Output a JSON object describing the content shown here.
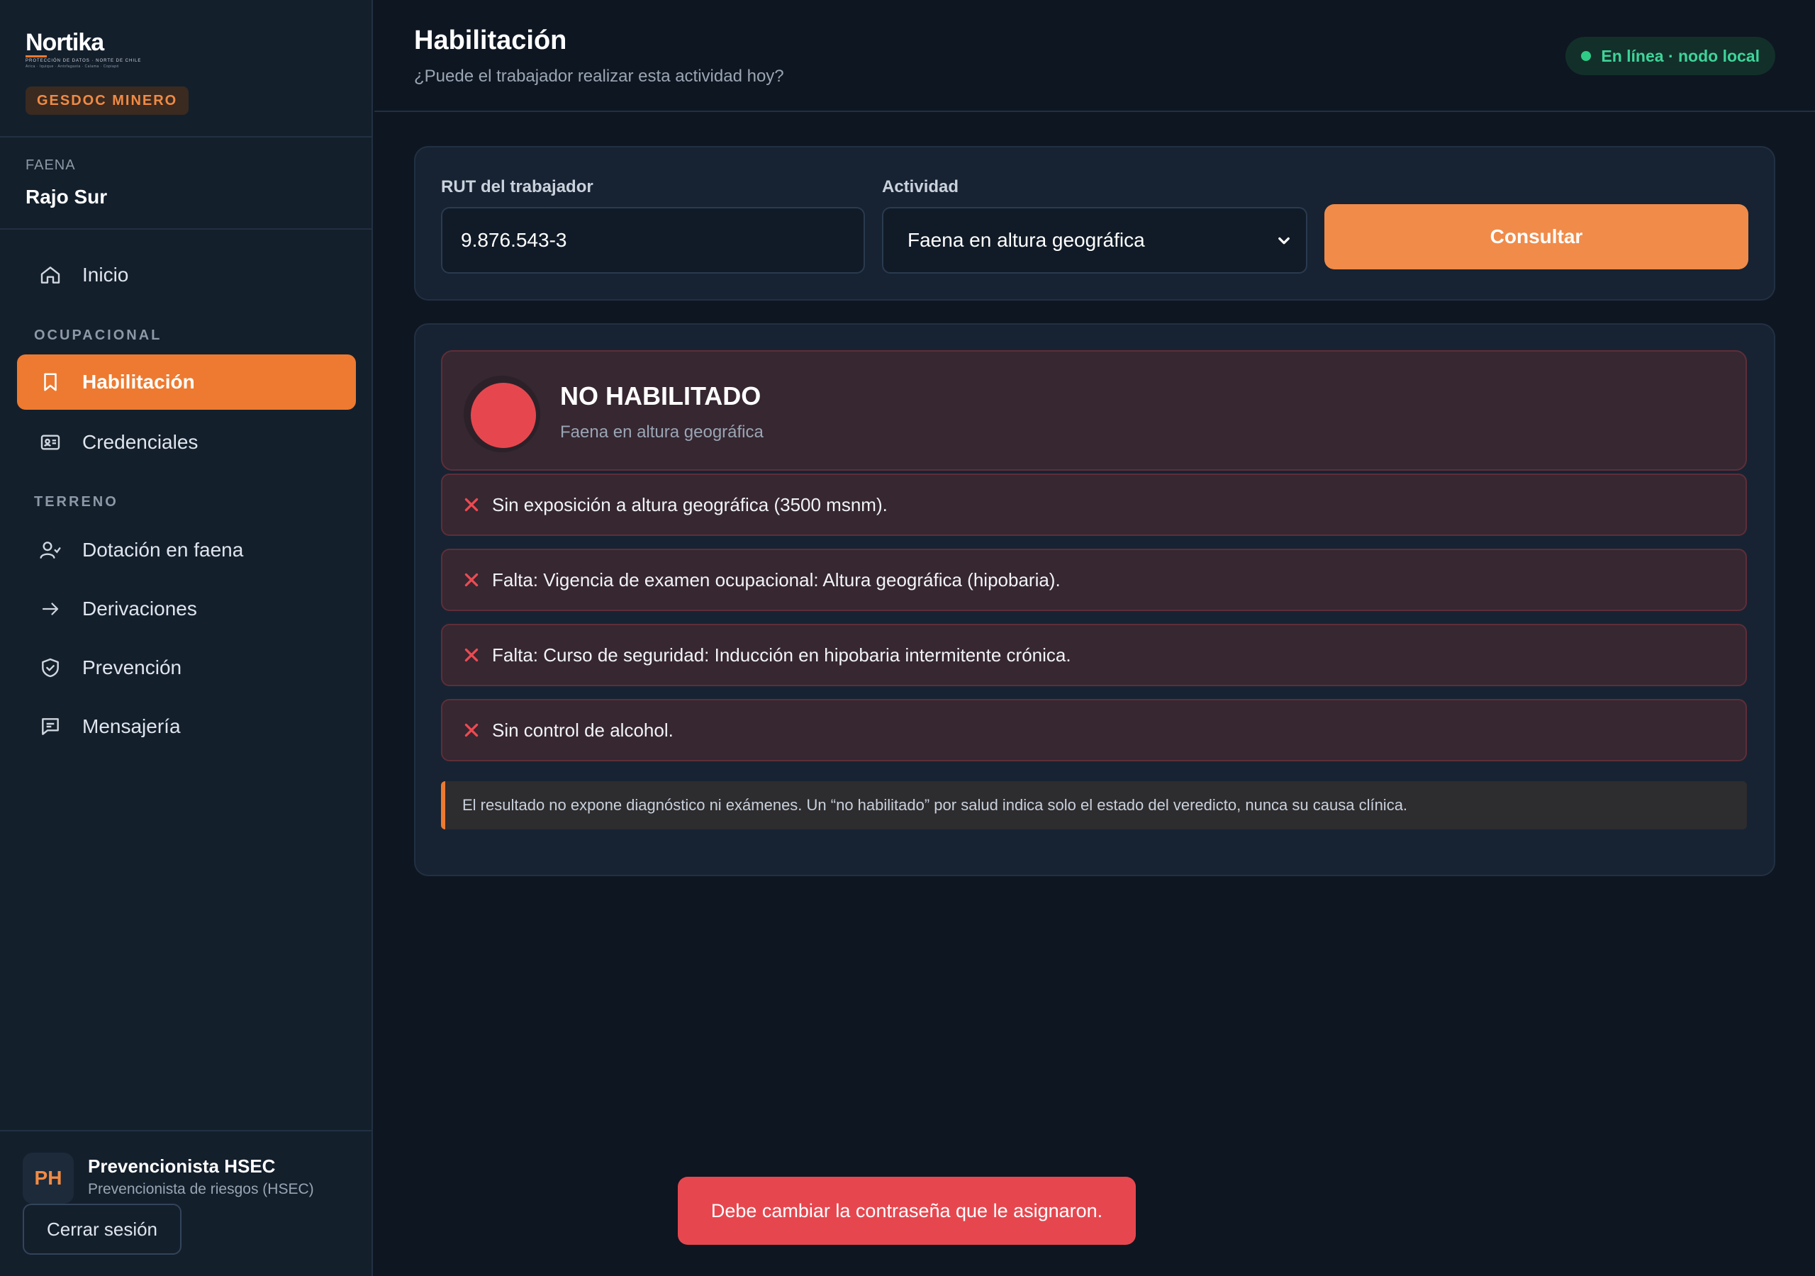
{
  "brand": {
    "logo": "Nortika",
    "tagline": "PROTECCIÓN DE DATOS · NORTE DE CHILE",
    "cities": "Arica · Iquique · Antofagasta · Calama · Copiapó",
    "product": "GESDOC MINERO"
  },
  "site": {
    "label": "FAENA",
    "value": "Rajo Sur"
  },
  "nav": {
    "home": "Inicio",
    "section_ocupacional": "OCUPACIONAL",
    "habilitacion": "Habilitación",
    "credenciales": "Credenciales",
    "section_terreno": "TERRENO",
    "dotacion": "Dotación en faena",
    "derivaciones": "Derivaciones",
    "prevencion": "Prevención",
    "mensajeria": "Mensajería"
  },
  "user": {
    "initials": "PH",
    "name": "Prevencionista HSEC",
    "role": "Prevencionista de riesgos (HSEC)",
    "logout": "Cerrar sesión"
  },
  "header": {
    "title": "Habilitación",
    "subtitle": "¿Puede el trabajador realizar esta actividad hoy?",
    "status": "En línea · nodo local"
  },
  "query": {
    "rut_label": "RUT del trabajador",
    "rut_value": "9.876.543-3",
    "activity_label": "Actividad",
    "activity_value": "Faena en altura geográfica",
    "submit": "Consultar"
  },
  "result": {
    "verdict": "NO HABILITADO",
    "activity": "Faena en altura geográfica",
    "reasons": [
      "Sin exposición a altura geográfica (3500 msnm).",
      "Falta: Vigencia de examen ocupacional: Altura geográfica (hipobaria).",
      "Falta: Curso de seguridad: Inducción en hipobaria intermitente crónica.",
      "Sin control de alcohol."
    ],
    "notice": "El resultado no expone diagnóstico ni exámenes. Un “no habilitado” por salud indica solo el estado del veredicto, nunca su causa clínica."
  },
  "toast": "Debe cambiar la contraseña que le asignaron.",
  "colors": {
    "accent": "#ed7a30",
    "danger": "#e6474f",
    "online": "#2ecc87",
    "background": "#0e1621",
    "sidebar": "#141f2c"
  }
}
